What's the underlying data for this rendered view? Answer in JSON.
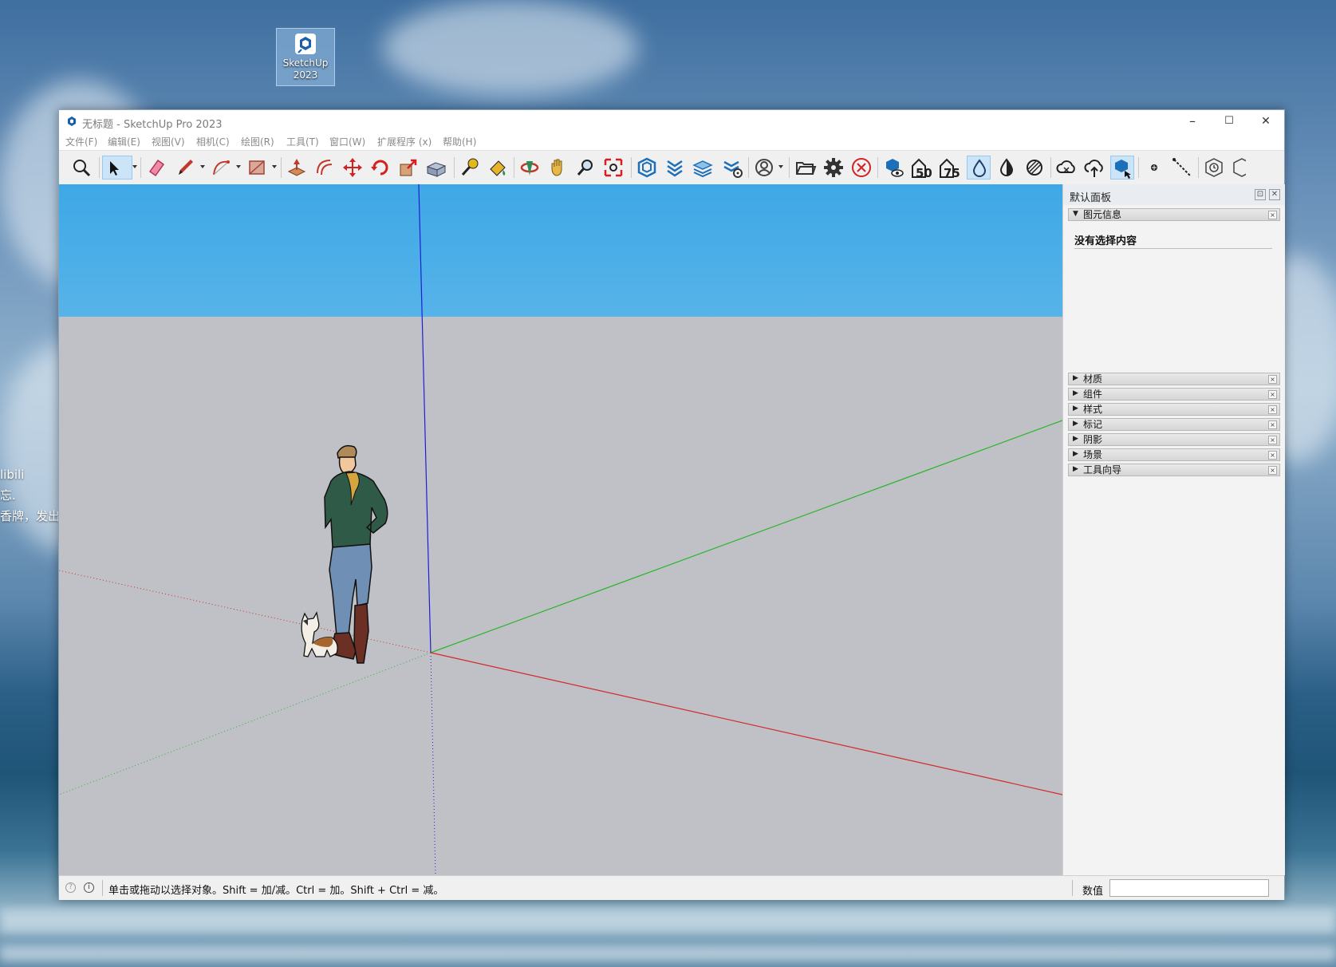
{
  "desktop": {
    "icon_label_line1": "SketchUp",
    "icon_label_line2": "2023",
    "fragments": [
      "libili",
      "忘.",
      "香牌，发出"
    ]
  },
  "window": {
    "title": "无标题 - SketchUp Pro 2023",
    "controls": {
      "minimize": "–",
      "maximize": "☐",
      "close": "✕"
    }
  },
  "menu": {
    "file": "文件(F)",
    "edit": "编辑(E)",
    "view": "视图(V)",
    "camera": "相机(C)",
    "draw": "绘图(R)",
    "tools": "工具(T)",
    "window": "窗口(W)",
    "extensions": "扩展程序 (x)",
    "help": "帮助(H)"
  },
  "toolbar": {
    "tools": [
      {
        "name": "zoom-extents-icon"
      },
      {
        "name": "select-icon",
        "active": true
      },
      {
        "name": "eraser-icon"
      },
      {
        "name": "pencil-icon"
      },
      {
        "name": "arc-icon"
      },
      {
        "name": "rectangle-icon"
      },
      {
        "name": "push-pull-icon"
      },
      {
        "name": "offset-icon"
      },
      {
        "name": "move-icon"
      },
      {
        "name": "rotate-icon"
      },
      {
        "name": "scale-icon"
      },
      {
        "name": "follow-me-icon"
      },
      {
        "name": "tape-measure-icon"
      },
      {
        "name": "paint-bucket-icon"
      },
      {
        "name": "orbit-icon"
      },
      {
        "name": "pan-icon"
      },
      {
        "name": "zoom-icon"
      },
      {
        "name": "zoom-window-icon"
      },
      {
        "name": "warehouse-icon"
      },
      {
        "name": "extension-warehouse-icon"
      },
      {
        "name": "layers-icon"
      },
      {
        "name": "extension-manager-icon"
      },
      {
        "name": "account-icon"
      },
      {
        "name": "open-folder-icon"
      },
      {
        "name": "settings-gear-icon"
      },
      {
        "name": "cancel-icon"
      },
      {
        "name": "model-viewer-icon"
      },
      {
        "name": "fifty-icon"
      },
      {
        "name": "seventy-five-icon"
      },
      {
        "name": "xray-drop-icon",
        "active": true
      },
      {
        "name": "contrast-icon"
      },
      {
        "name": "hatch-icon"
      },
      {
        "name": "cloud-sync-icon"
      },
      {
        "name": "cloud-upload-icon"
      },
      {
        "name": "trimble-connect-icon",
        "active": true
      },
      {
        "name": "point-icon"
      },
      {
        "name": "dashed-line-icon"
      },
      {
        "name": "history-icon"
      }
    ],
    "label_fifty": "50",
    "label_seventy_five": "75"
  },
  "tray": {
    "title": "默认面板",
    "pin": "⊡",
    "close": "✕",
    "entity_info": {
      "label": "图元信息",
      "message": "没有选择内容"
    },
    "sections": [
      "材质",
      "组件",
      "样式",
      "标记",
      "阴影",
      "场景",
      "工具向导"
    ]
  },
  "status": {
    "message": "单击或拖动以选择对象。Shift = 加/减。Ctrl = 加。Shift + Ctrl = 减。",
    "value_label": "数值",
    "value": ""
  },
  "colors": {
    "sky_top": "#3ea8e6",
    "ground": "#c0c1c6",
    "axis_red": "#d22a2a",
    "axis_green": "#2bb52b",
    "axis_blue": "#1e1ed2",
    "active_tool": "#cce4f7"
  }
}
